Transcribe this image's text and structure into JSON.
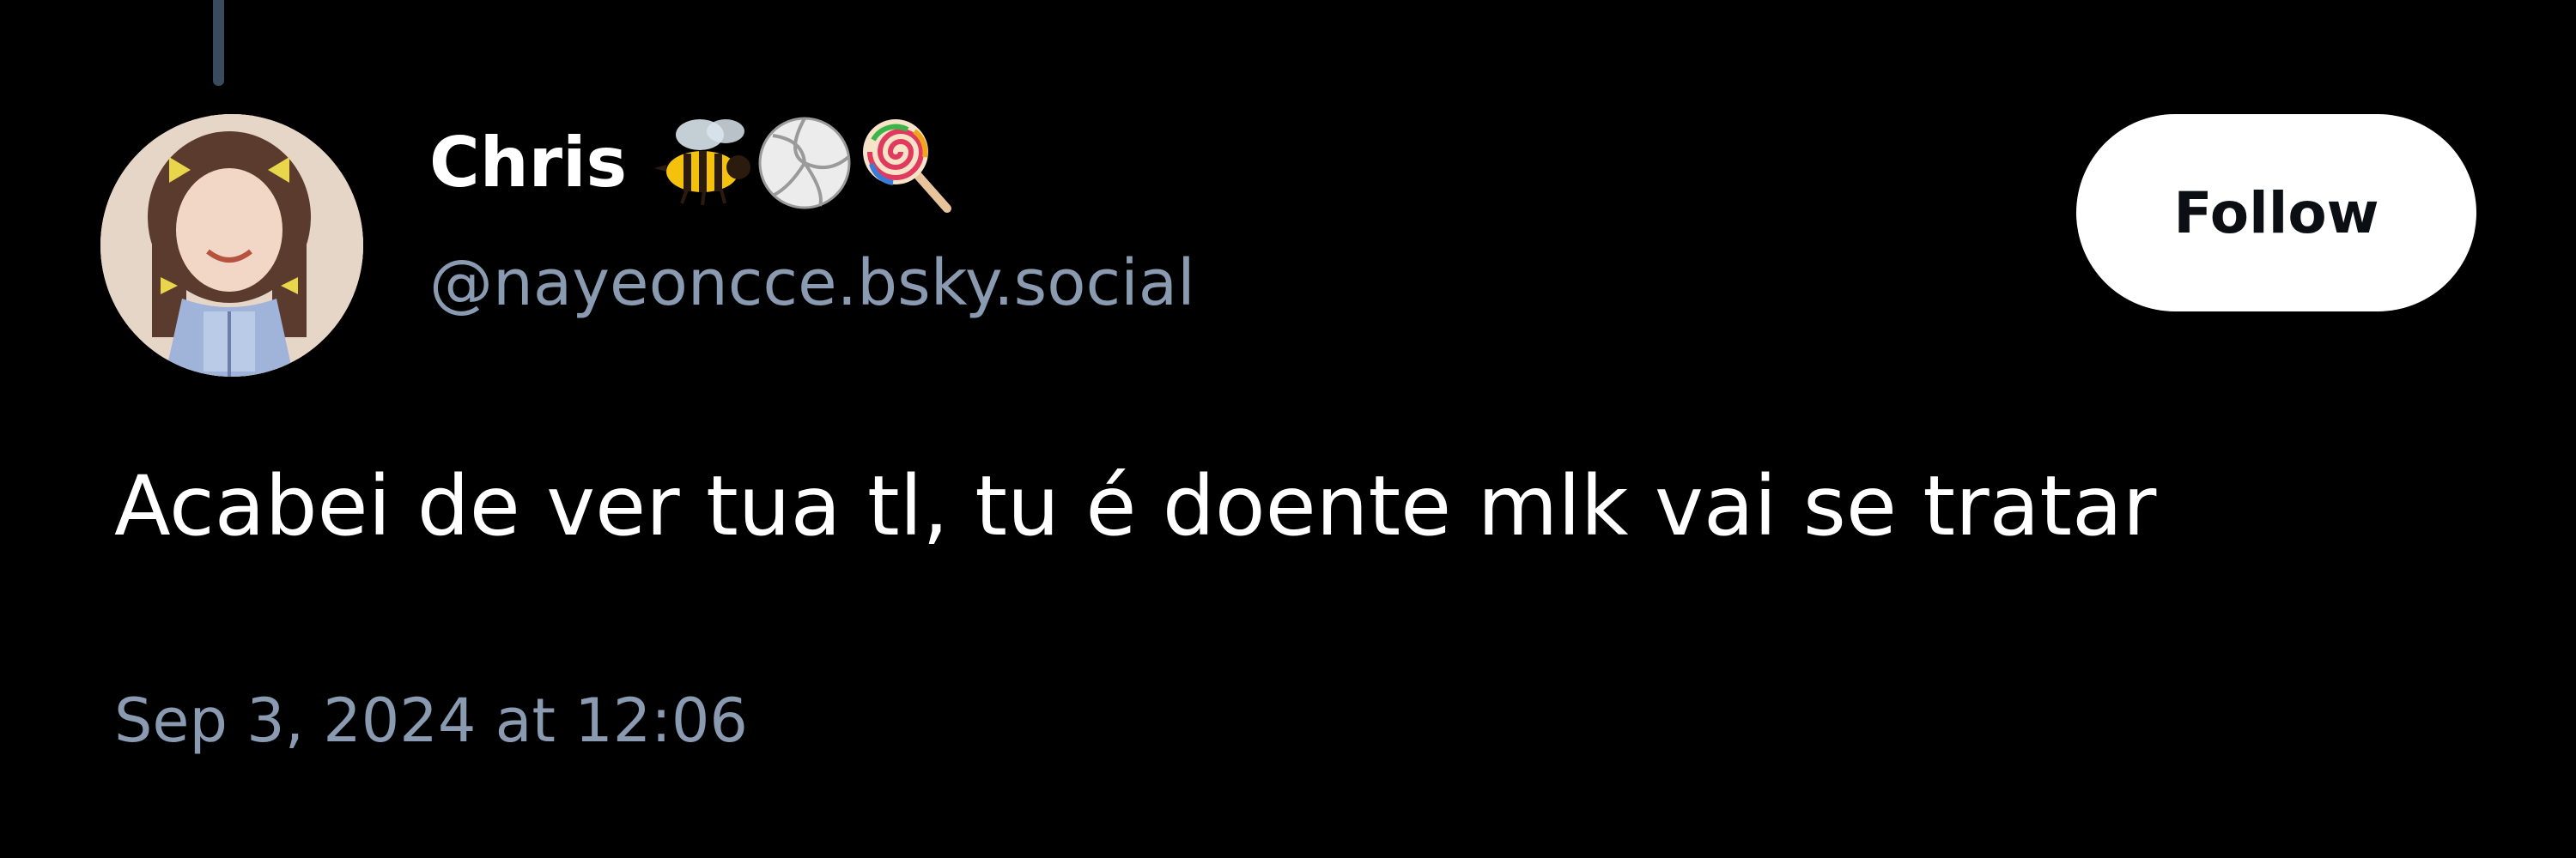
{
  "post": {
    "author": {
      "display_name": "Chris",
      "name_emojis": [
        "bee-emoji",
        "volleyball-emoji",
        "lollipop-emoji"
      ],
      "handle": "@nayeoncce.bsky.social",
      "avatar": "avatar-photo"
    },
    "follow_label": "Follow",
    "text": "Acabei de ver tua tl, tu é doente mlk vai se tratar",
    "timestamp": "Sep 3, 2024 at 12:06"
  },
  "colors": {
    "background": "#000000",
    "primary_text": "#ffffff",
    "secondary_text": "#8a9ab0",
    "thread_line": "#3a4b5e",
    "button_bg": "#ffffff",
    "button_text": "#0b0f14"
  }
}
